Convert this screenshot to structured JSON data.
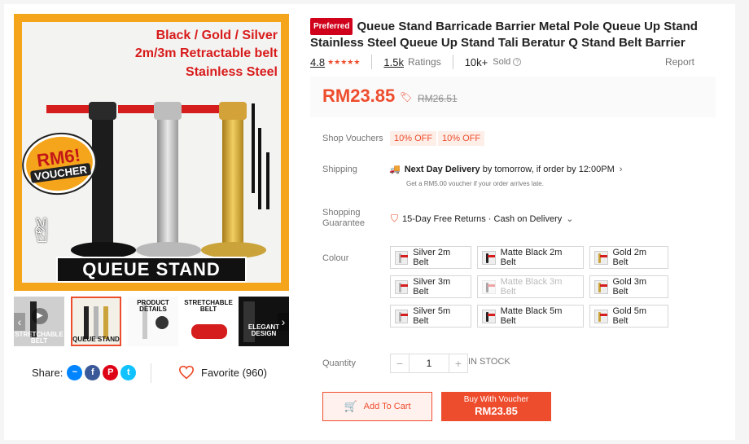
{
  "gallery": {
    "main_header": [
      "Black / Gold / Silver",
      "2m/3m Retractable belt",
      "Stainless Steel"
    ],
    "voucher_line1": "RM6!",
    "voucher_line2": "VOUCHER",
    "banner": "QUEUE STAND",
    "thumb_labels": [
      "STRETCHABLE BELT",
      "QUEUE STAND",
      "PRODUCT DETAILS",
      "STRETCHABLE BELT",
      "ELEGANT DESIGN"
    ],
    "prev_icon": "chevron-left-icon",
    "next_icon": "chevron-right-icon"
  },
  "share": {
    "label": "Share:",
    "networks": [
      {
        "icon": "messenger-icon",
        "glyph": "~",
        "color": "#0084ff"
      },
      {
        "icon": "facebook-icon",
        "glyph": "f",
        "color": "#3b5999"
      },
      {
        "icon": "pinterest-icon",
        "glyph": "P",
        "color": "#de0217"
      },
      {
        "icon": "twitter-icon",
        "glyph": "t",
        "color": "#10c2ff"
      }
    ]
  },
  "favorite": {
    "label": "Favorite (960)",
    "icon": "heart-icon"
  },
  "product": {
    "badge": "Preferred",
    "title": "Queue Stand Barricade Barrier Metal Pole Queue Up Stand Stainless Steel Queue Up Stand Tali Beratur Q Stand Belt Barrier",
    "rating": "4.8",
    "stars": "★★★★★",
    "ratings_count": "1.5k",
    "ratings_label": "Ratings",
    "sold_count": "10k+",
    "sold_label": "Sold",
    "report": "Report",
    "price": "RM23.85",
    "old_price": "RM26.51"
  },
  "vouchers": {
    "label": "Shop Vouchers",
    "items": [
      "10% OFF",
      "10% OFF"
    ]
  },
  "shipping": {
    "label": "Shipping",
    "headline": "Next Day Delivery",
    "detail": " by tomorrow, if order by 12:00PM",
    "sub": "Get a RM5.00 voucher if your order arrives late."
  },
  "guarantee": {
    "label_line1": "Shopping",
    "label_line2": "Guarantee",
    "text": "15-Day Free Returns · Cash on Delivery"
  },
  "colour": {
    "label": "Colour",
    "options": [
      {
        "label": "Silver 2m Belt",
        "pole": "#b5b5b5",
        "disabled": false
      },
      {
        "label": "Matte Black 2m Belt",
        "pole": "#222222",
        "disabled": false
      },
      {
        "label": "Gold 2m Belt",
        "pole": "#caa33a",
        "disabled": false
      },
      {
        "label": "Silver 3m Belt",
        "pole": "#b5b5b5",
        "disabled": false
      },
      {
        "label": "Matte Black 3m Belt",
        "pole": "#222222",
        "disabled": true
      },
      {
        "label": "Gold 3m Belt",
        "pole": "#caa33a",
        "disabled": false
      },
      {
        "label": "Silver 5m Belt",
        "pole": "#b5b5b5",
        "disabled": false
      },
      {
        "label": "Matte Black 5m Belt",
        "pole": "#222222",
        "disabled": false
      },
      {
        "label": "Gold 5m Belt",
        "pole": "#caa33a",
        "disabled": false
      }
    ]
  },
  "quantity": {
    "label": "Quantity",
    "value": "1",
    "minus": "−",
    "plus": "+",
    "stock": "IN STOCK"
  },
  "actions": {
    "add_to_cart": "Add To Cart",
    "buy_line1": "Buy With Voucher",
    "buy_price": "RM23.85"
  },
  "colors": {
    "accent": "#ee4d2d",
    "badge": "#d0011b"
  }
}
